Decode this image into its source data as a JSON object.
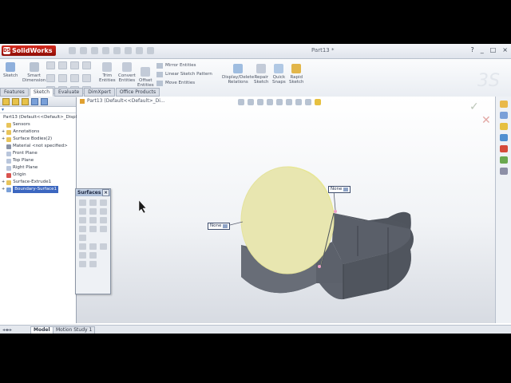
{
  "app": {
    "brand": "SolidWorks",
    "brand_mark": "DS",
    "doc_title": "Part13 *",
    "window_controls": [
      "?",
      "_",
      "□",
      "×"
    ]
  },
  "ribbon": {
    "sketch": "Sketch",
    "smart_dimension": [
      "Smart",
      "Dimension"
    ],
    "trim": [
      "Trim",
      "Entities"
    ],
    "convert": [
      "Convert",
      "Entities"
    ],
    "offset": [
      "Offset",
      "Entities"
    ],
    "mirror": "Mirror Entities",
    "linear_pattern": "Linear Sketch Pattern",
    "move": "Move Entities",
    "display_delete": [
      "Display/Delete",
      "Relations"
    ],
    "repair": [
      "Repair",
      "Sketch"
    ],
    "quick_snaps": [
      "Quick",
      "Snaps"
    ],
    "rapid_sketch": [
      "Rapid",
      "Sketch"
    ]
  },
  "command_tabs": [
    "Features",
    "Sketch",
    "Evaluate",
    "DimXpert",
    "Office Products"
  ],
  "active_tab": "Sketch",
  "feature_tree": {
    "root": "Part13  (Default<<Default>_Display",
    "items": [
      "Sensors",
      "Annotations",
      "Surface Bodies(2)",
      "Material <not specified>",
      "Front Plane",
      "Top Plane",
      "Right Plane",
      "Origin",
      "Surface-Extrude1",
      "Boundary-Surface1"
    ],
    "selected": "Boundary-Surface1"
  },
  "viewport": {
    "breadcrumb": "Part13  (Default<<Default>_Di..."
  },
  "palette": {
    "title": "Surfaces",
    "close": "×"
  },
  "tags": {
    "left": "None",
    "right": "None"
  },
  "confirm": {
    "ok": "✓",
    "cancel": "✕"
  },
  "bottom_tabs": [
    "Model",
    "Motion Study 1"
  ],
  "colors": {
    "surface": "#e8e6b0",
    "wall": "#5e636d",
    "selection": "#f5a0c8",
    "accent": "#c21a0e"
  }
}
